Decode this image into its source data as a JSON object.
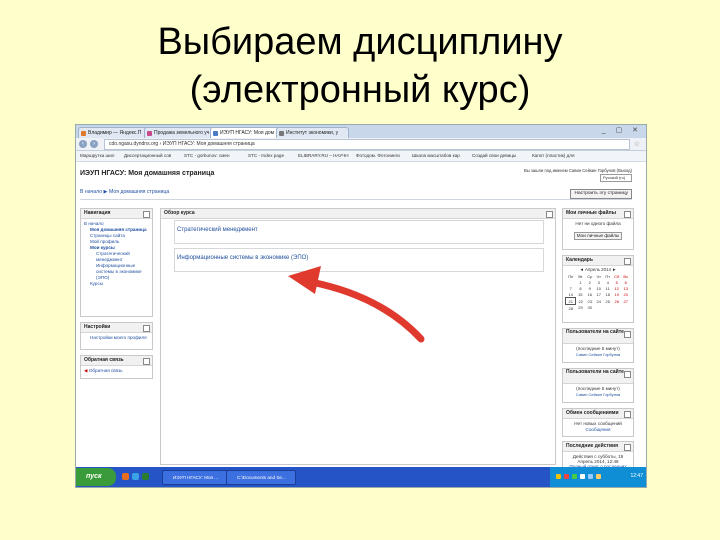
{
  "slide": {
    "title_line1": "Выбираем дисциплину",
    "title_line2": "(электронный курс)"
  },
  "browser": {
    "tabs": [
      {
        "label": "Владимир — Яндекс.П"
      },
      {
        "label": "Продажа земельного уч"
      },
      {
        "label": "ИЭУП НГАСУ: Моя дом",
        "active": true
      },
      {
        "label": "Институт экономики, у"
      }
    ],
    "window_controls": "_ ▢ ✕",
    "address": "cdo.ngasu.dyndns.org  ›  ИЭУП НГАСУ: Моя домашняя страница",
    "bookmarks": [
      "Маршрутка шил",
      "Диссертационный сов",
      "STC - gorbunov: смен",
      "STC - Index page",
      "ELIBRARY.RU – НАУЧН",
      "Фотодом. Фотонинги",
      "Шкала масштабов кар",
      "Создай свои девицы",
      "Капот (пластик) для"
    ]
  },
  "page": {
    "site_title": "ИЭУП НГАСУ: Моя домашняя страница",
    "login_info": "Вы зашли под именем Савин Сейкин Горбунов (Выход)",
    "language": "Русский (ru)",
    "breadcrumb": "В начало ▶ Моя домашняя страница",
    "customize_button": "Настроить эту страницу"
  },
  "nav_block": {
    "title": "Навигация",
    "items": [
      "В начало",
      "Моя домашняя страница",
      "Страницы сайта",
      "Мой профиль",
      "Мои курсы",
      "Стратегический менеджмент",
      "Информационные системы в экономике (ЭПО)",
      "Курсы"
    ]
  },
  "settings_block": {
    "title": "Настройки",
    "items": [
      "Настройки моего профиля"
    ]
  },
  "feedback_block": {
    "title": "Обратная связь",
    "items": [
      "Обратная связь"
    ]
  },
  "overview": {
    "title": "Обзор курса",
    "courses": [
      "Стратегический менеджмент",
      "Информационные системы в экономике (ЭПО)"
    ]
  },
  "files_block": {
    "title": "Мои личные файлы",
    "empty": "Нет ни одного файла",
    "button": "Мои личные файлы"
  },
  "calendar_block": {
    "title": "Календарь",
    "month": "Апрель 2014",
    "weekdays": [
      "Пн",
      "Вт",
      "Ср",
      "Чт",
      "Пт",
      "Сб",
      "Вс"
    ],
    "weeks": [
      [
        "",
        "1",
        "2",
        "3",
        "4",
        "5",
        "6"
      ],
      [
        "7",
        "8",
        "9",
        "10",
        "11",
        "12",
        "13"
      ],
      [
        "14",
        "15",
        "16",
        "17",
        "18",
        "19",
        "20"
      ],
      [
        "21",
        "22",
        "23",
        "24",
        "25",
        "26",
        "27"
      ],
      [
        "28",
        "29",
        "30",
        "",
        "",
        "",
        ""
      ]
    ]
  },
  "users_block1": {
    "title": "Пользователи на сайте",
    "note": "(последние 5 минут)",
    "user": "Савин Сейкин Горбунов"
  },
  "users_block2": {
    "title": "Пользователи на сайте",
    "note": "(последние 5 минут)",
    "user": "Савин Сейкин Горбунов"
  },
  "messages_block": {
    "title": "Обмен сообщениями",
    "line1": "Нет новых сообщений",
    "line2": "Сообщения"
  },
  "recent_block": {
    "title": "Последние действия",
    "line1": "Действия с субботы, 19",
    "line2": "Апрель 2014, 12:48",
    "line3": "Полный отчет о последних"
  },
  "taskbar": {
    "start_label": "пуск",
    "tasks": [
      "ИЭУП НГАСУ: Моя ...",
      "С:\\Documents and Se..."
    ],
    "clock": "12:47"
  },
  "colors": {
    "slide_bg": "#ffffcc",
    "arrow": "#e03a2f",
    "link": "#2050a0",
    "taskbar": "#2554c7"
  }
}
